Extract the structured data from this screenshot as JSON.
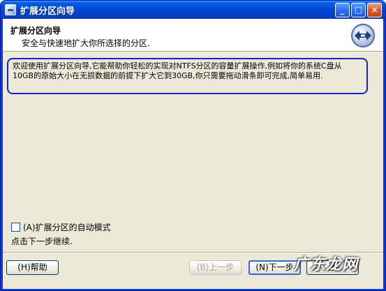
{
  "window": {
    "title": "扩展分区向导",
    "minimize_label": "_",
    "maximize_label": "□",
    "close_label": "×"
  },
  "header": {
    "title": "扩展分区向导",
    "subtitle": "安全与快速地扩大你所选择的分区."
  },
  "description": "欢迎使用扩展分区向导,它能帮助你轻松的实现对NTFS分区的容量扩展操作,例如将你的系统C盘从10GB的原始大小在无损数据的前提下扩大它到30GB,你只需要拖动滑条即可完成,简单易用.",
  "auto_mode": {
    "label": "(A)扩展分区的自动模式",
    "checked": false
  },
  "continue_hint": "点击下一步继续.",
  "buttons": {
    "help": "(H)帮助",
    "back": "(B)上一步",
    "next": "(N)下一步",
    "cancel": "消"
  },
  "watermark": "广东龙网",
  "colors": {
    "titlebar": "#0a5ce6",
    "dialog_bg": "#ece9d8",
    "highlight_border": "#1a20c8"
  }
}
